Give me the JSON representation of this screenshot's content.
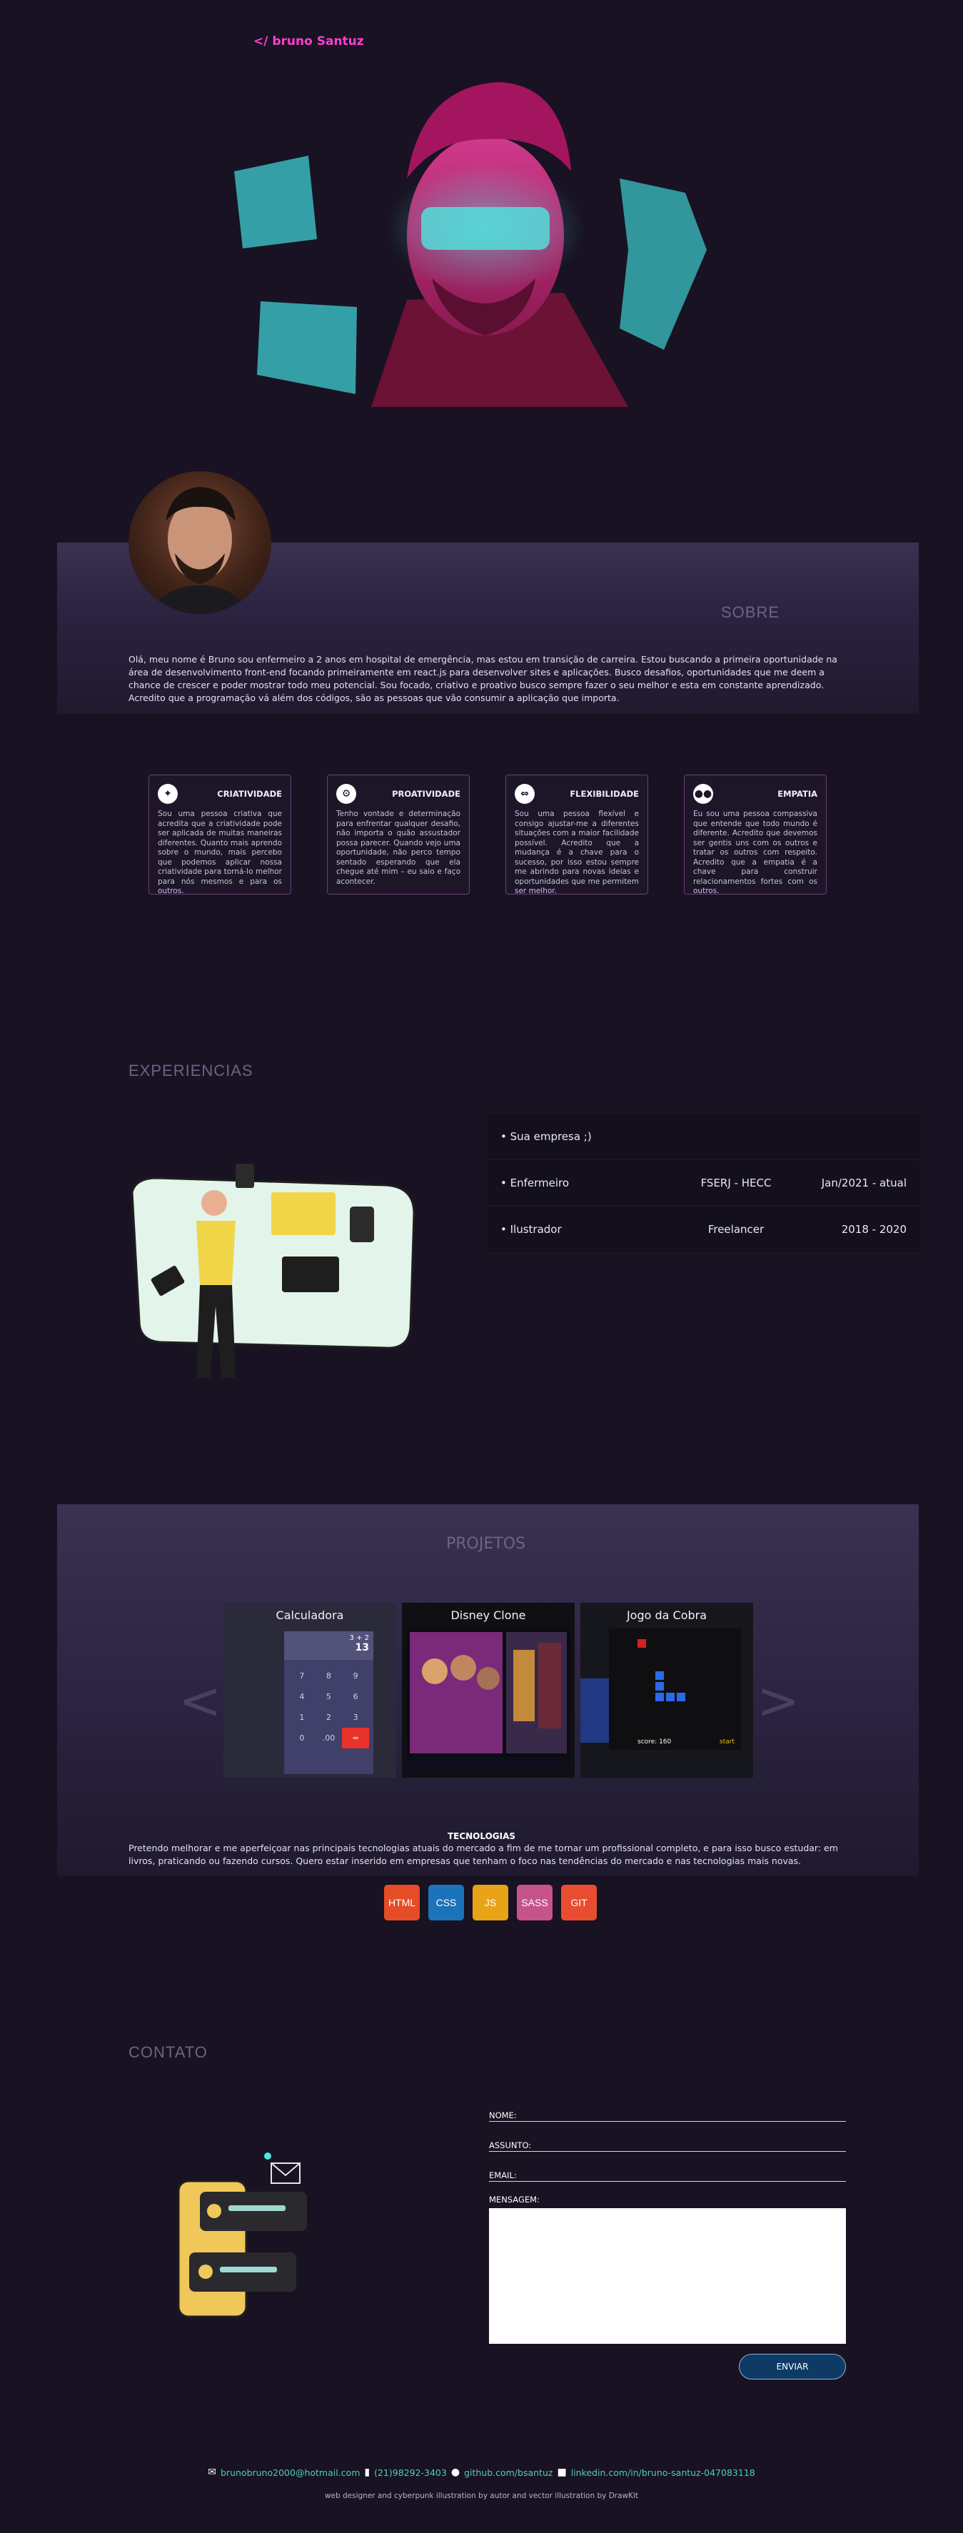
{
  "header": {
    "logo": "</ bruno Santuz"
  },
  "sobre": {
    "title": "SOBRE",
    "text": "Olá, meu nome é Bruno sou enfermeiro a 2 anos em hospital de emergência, mas estou em transição de carreira. Estou buscando a primeira oportunidade na área de desenvolvimento front-end focando primeiramente em react.js para desenvolver sites e aplicações. Busco desafios, oportunidades que me deem a chance de crescer e poder mostrar todo meu potencial. Sou focado, criativo e proativo busco sempre fazer o seu melhor e esta em constante aprendizado. Acredito que a programação vá além dos códigos, são as pessoas que vão consumir a aplicação que importa."
  },
  "cards": [
    {
      "icon": "lightbulb-icon",
      "glyph": "💡",
      "title": "CRIATIVIDADE",
      "text": "Sou uma pessoa criativa que acredita que a criatividade pode ser aplicada de muitas maneiras diferentes. Quanto mais aprendo sobre o mundo, mais percebo que podemos aplicar nossa criatividade para torná-lo melhor para nós mesmos e para os outros."
    },
    {
      "icon": "gears-icon",
      "glyph": "⚙",
      "title": "PROATIVIDADE",
      "text": "Tenho vontade e determinação para enfrentar qualquer desafio, não importa o quão assustador possa parecer. Quando vejo uma oportunidade, não perco tempo sentado esperando que ela chegue até mim – eu saio e faço acontecer."
    },
    {
      "icon": "flex-icon",
      "glyph": "⇔",
      "title": "FLEXIBILIDADE",
      "text": "Sou uma pessoa flexível e consigo ajustar-me a diferentes situações com a maior facilidade possível. Acredito que a mudança é a chave para o sucesso, por isso estou sempre me abrindo para novas ideias e oportunidades que me permitem ser melhor."
    },
    {
      "icon": "people-icon",
      "glyph": "👥",
      "title": "EMPATIA",
      "text": "Eu sou uma pessoa compassiva que entende que todo mundo é diferente. Acredito que devemos ser gentis uns com os outros e tratar os outros com respeito. Acredito que a empatia é a chave para construir relacionamentos fortes com os outros."
    }
  ],
  "experiencias": {
    "title": "EXPERIENCIAS",
    "rows": [
      {
        "c1": "• Sua empresa ;)",
        "c2": "",
        "c3": ""
      },
      {
        "c1": "• Enfermeiro",
        "c2": "FSERJ - HECC",
        "c3": "Jan/2021 - atual"
      },
      {
        "c1": "• Ilustrador",
        "c2": "Freelancer",
        "c3": "2018 - 2020"
      }
    ]
  },
  "projetos": {
    "title": "PROJETOS",
    "prev": "<",
    "next": ">",
    "items": [
      {
        "name": "Calculadora"
      },
      {
        "name": "Disney Clone"
      },
      {
        "name": "Jogo da Cobra",
        "score": "score: 160",
        "start": "start"
      }
    ],
    "calc": {
      "display_top": "3 + 2",
      "display_value": "13",
      "keys": [
        "7",
        "8",
        "9",
        "4",
        "5",
        "6",
        "1",
        "2",
        "3",
        "0",
        ".00",
        "="
      ]
    },
    "tech_title": "TECNOLOGIAS",
    "tech_text": "Pretendo melhorar e me aperfeiçoar nas principais tecnologias atuais do mercado a fim de me tornar um profissional completo, e para isso busco estudar: em livros, praticando ou fazendo cursos. Quero estar inserido em empresas que tenham o foco nas tendências do mercado e nas tecnologias mais novas.",
    "badges": [
      {
        "label": "HTML",
        "color": "#e44d26"
      },
      {
        "label": "CSS",
        "color": "#1b73ba"
      },
      {
        "label": "JS",
        "color": "#e8a317"
      },
      {
        "label": "SASS",
        "color": "#c6538c"
      },
      {
        "label": "GIT",
        "color": "#e84d31"
      }
    ]
  },
  "contato": {
    "title": "CONTATO",
    "nome_label": "NOME:",
    "assunto_label": "ASSUNTO:",
    "email_label": "EMAIL:",
    "mensagem_label": "MENSAGEM:",
    "send": "ENVIAR"
  },
  "footer": {
    "email": "brunobruno2000@hotmail.com",
    "phone": "(21)98292-3403",
    "github": "github.com/bsantuz",
    "linkedin": "linkedin.com/in/bruno-santuz-047083118",
    "credits": "web designer and cyberpunk illustration by autor and vector illustration by DrawKit"
  },
  "colors": {
    "accent": "#ff3fcf",
    "cyan": "#4fe6e0",
    "band": "#3b3152"
  }
}
